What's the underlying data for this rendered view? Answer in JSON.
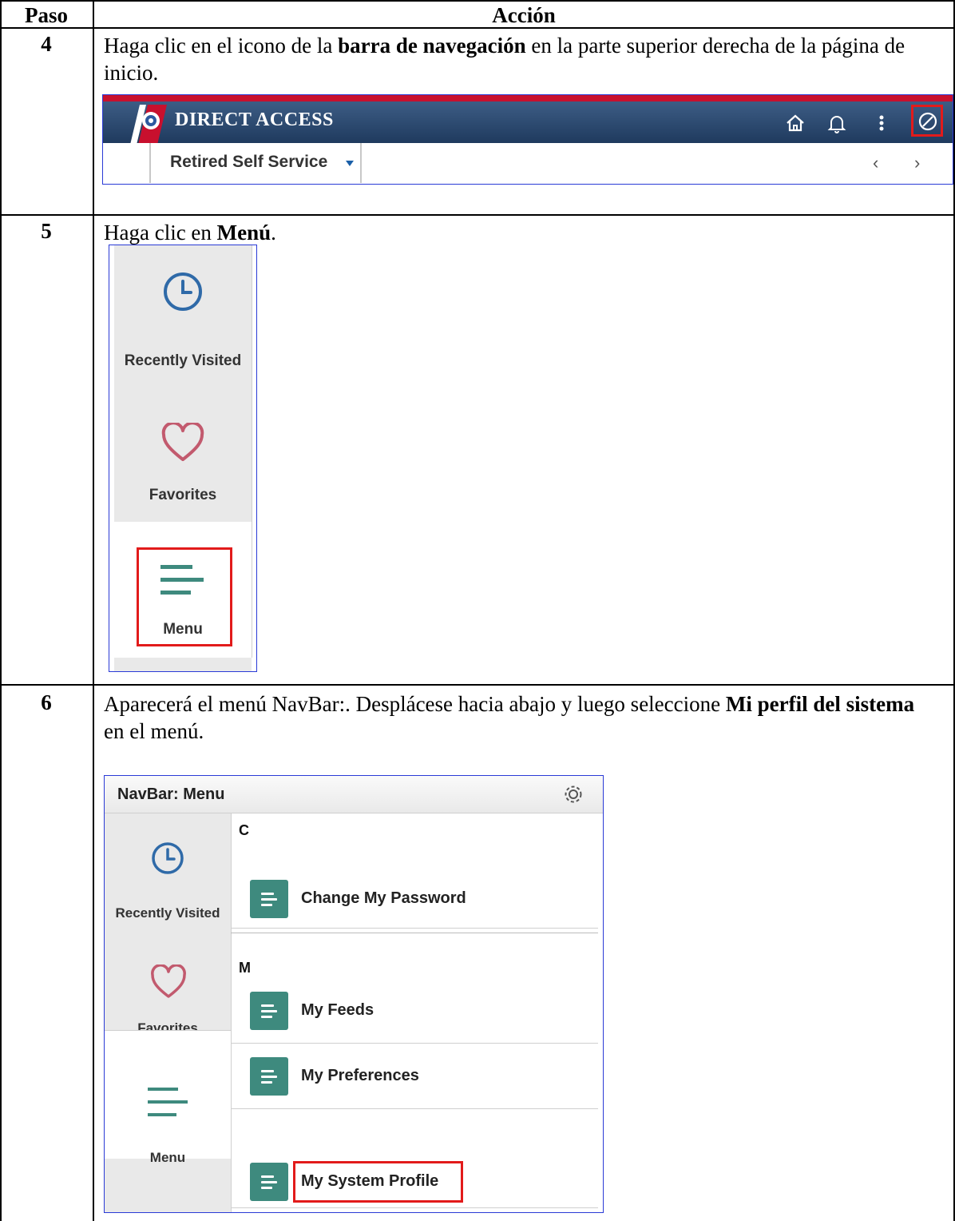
{
  "table": {
    "header_step": "Paso",
    "header_action": "Acción"
  },
  "step4": {
    "number": "4",
    "text_before": "Haga clic en el icono de  la ",
    "text_bold": "barra de navegación",
    "text_after": " en la parte superior derecha de la página de inicio.",
    "app_title": "DIRECT ACCESS",
    "tab_label": "Retired Self Service",
    "prev_arrow": "‹",
    "next_arrow": "›",
    "brand_color": "#1f3a5e",
    "accent_color": "#c8102e",
    "icons": [
      "home-icon",
      "bell-icon",
      "more-vertical-icon",
      "navbar-compass-icon"
    ]
  },
  "step5": {
    "number": "5",
    "text_before": "Haga clic en ",
    "text_bold": "Menú",
    "text_after": ".",
    "items": {
      "recent": "Recently Visited",
      "favorites": "Favorites",
      "menu": "Menu"
    }
  },
  "step6": {
    "number": "6",
    "text_before": "Aparecerá el menú NavBar:.  Desplácese hacia abajo y luego seleccione ",
    "text_bold1": "Mi perfil del sistema",
    "text_after": " en el menú.",
    "panel_title": "NavBar: Menu",
    "side": {
      "recent": "Recently Visited",
      "favorites": "Favorites",
      "menu": "Menu"
    },
    "letter_c": "C",
    "letter_m": "M",
    "entries": [
      "Change My Password",
      "My Feeds",
      "My Preferences",
      "My System Profile"
    ],
    "button_color": "#3e8a7e",
    "highlight_color": "#e21b1b"
  }
}
